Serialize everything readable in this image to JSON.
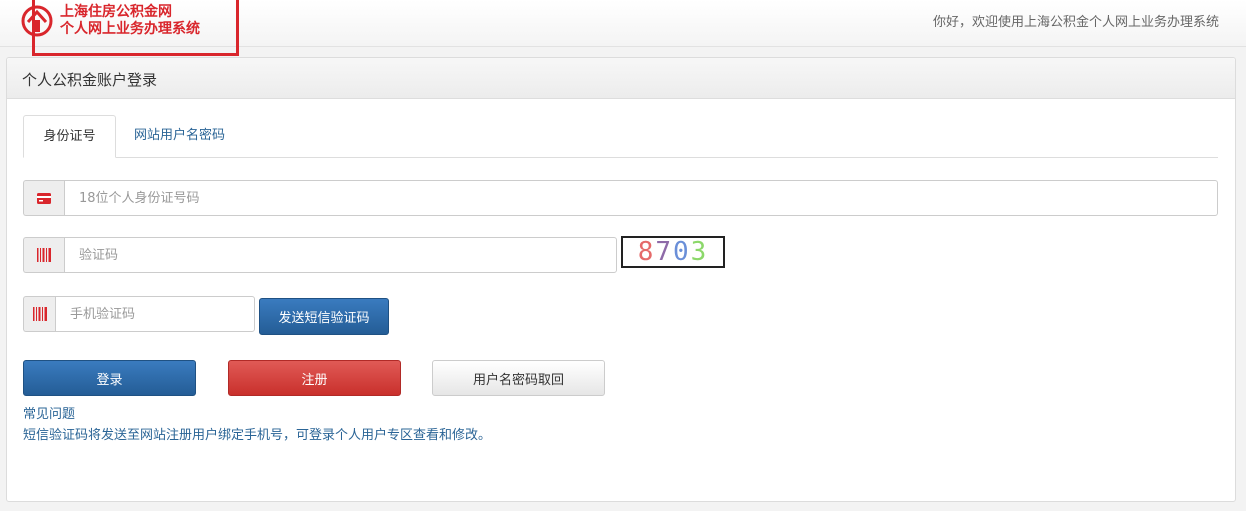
{
  "header": {
    "logo_line1": "上海住房公积金网",
    "logo_line2": "个人网上业务办理系统",
    "welcome_text": "你好，欢迎使用上海公积金个人网上业务办理系统",
    "brand_color": "#d9262c"
  },
  "panel": {
    "title": "个人公积金账户登录"
  },
  "tabs": [
    {
      "label": "身份证号",
      "active": true
    },
    {
      "label": "网站用户名密码",
      "active": false
    }
  ],
  "form": {
    "id_number": {
      "placeholder": "18位个人身份证号码",
      "icon": "id-card-icon"
    },
    "captcha": {
      "placeholder": "验证码",
      "icon": "barcode-icon",
      "image_text": "8703"
    },
    "sms": {
      "placeholder": "手机验证码",
      "icon": "barcode-icon",
      "send_label": "发送短信验证码"
    }
  },
  "actions": {
    "login_label": "登录",
    "register_label": "注册",
    "recover_label": "用户名密码取回"
  },
  "footer": {
    "faq_label": "常见问题",
    "sms_note": "短信验证码将发送至网站注册用户绑定手机号，可登录个人用户专区查看和修改。"
  },
  "colors": {
    "primary": "#245d96",
    "danger": "#c9302c",
    "link": "#2a6496"
  }
}
